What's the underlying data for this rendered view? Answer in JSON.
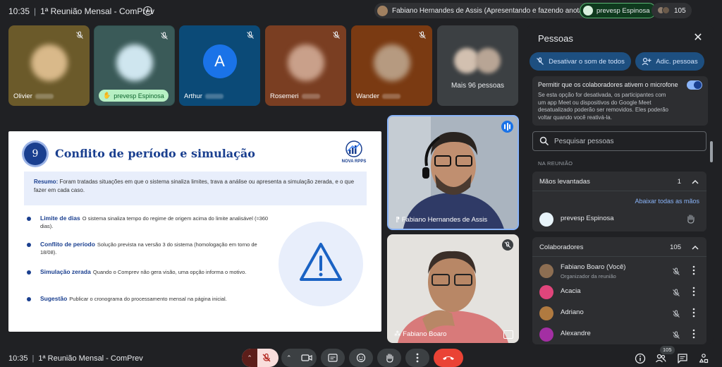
{
  "topbar": {
    "time": "10:35",
    "meeting_title": "1ª Reunião Mensal - ComPrev",
    "presenter": "Fabiano Hernandes de Assis (Apresentando e fazendo anotações)",
    "speaking": "prevesp Espinosa",
    "people_count": "105"
  },
  "tiles": [
    {
      "name": "Olivier",
      "bg": "#6b5a2a",
      "face": "#d9b98a"
    },
    {
      "name": "prevesp Espinosa",
      "bg": "#3a5a58",
      "face": "#cfe6ef"
    },
    {
      "name": "Arthur",
      "letter": "A",
      "bg": "#0b4a77"
    },
    {
      "name": "Rosemeri",
      "bg": "#7a3e22",
      "face": "#c9a08a"
    },
    {
      "name": "Wander",
      "bg": "#7a3a12",
      "face": "#b69a80"
    },
    {
      "more": "Mais 96 pessoas",
      "bg": "#3c4043"
    }
  ],
  "slide": {
    "number": "9",
    "title": "Conflito de período e simulação",
    "logo_text": "NOVA RPPS",
    "summary_label": "Resumo:",
    "summary_text": "Foram tratadas situações em que o sistema sinaliza limites, trava a análise ou apresenta a simulação zerada, e o que fazer em cada caso.",
    "bullets": [
      {
        "label": "Limite de dias",
        "text": "O sistema sinaliza tempo do regime de origem acima do limite analisável (≈360 dias)."
      },
      {
        "label": "Conflito de período",
        "text": "Solução prevista na versão 3 do sistema (homologação em torno de 18/08)."
      },
      {
        "label": "Simulação zerada",
        "text": "Quando o Comprev não gera visão, uma opção informa o motivo."
      },
      {
        "label": "Sugestão",
        "text": "Publicar o cronograma do processamento mensal na página inicial."
      }
    ]
  },
  "videos": {
    "main_name": "Fabiano Hernandes de Assis",
    "second_name": "Fabiano Boaro"
  },
  "panel": {
    "title": "Pessoas",
    "mute_all": "Desativar o som de todos",
    "add_people": "Adic. pessoas",
    "permission_title": "Permitir que os colaboradores ativem o microfone",
    "permission_desc": "Se esta opção for desativada, os participantes com um app Meet ou dispositivos do Google Meet desatualizado poderão ser removidos. Eles poderão voltar quando você reativá-la.",
    "search_placeholder": "Pesquisar pessoas",
    "section_label": "NA REUNIÃO",
    "raised_hands": {
      "label": "Mãos levantadas",
      "count": "1",
      "lower_all": "Abaixar todas as mãos",
      "person": "prevesp Espinosa"
    },
    "collaborators": {
      "label": "Colaboradores",
      "count": "105",
      "people": [
        {
          "name": "Fabiano Boaro (Você)",
          "sub": "Organizador da reunião",
          "color": "#8d6e52"
        },
        {
          "name": "Acacia",
          "sub": "",
          "color": "#e0457b"
        },
        {
          "name": "Adriano",
          "sub": "",
          "color": "#b07a40"
        },
        {
          "name": "Alexandre",
          "sub": "",
          "color": "#a32fa3"
        }
      ]
    }
  },
  "bottombar": {
    "time": "10:35",
    "meeting_title": "1ª Reunião Mensal - ComPrev",
    "people_badge": "105"
  }
}
